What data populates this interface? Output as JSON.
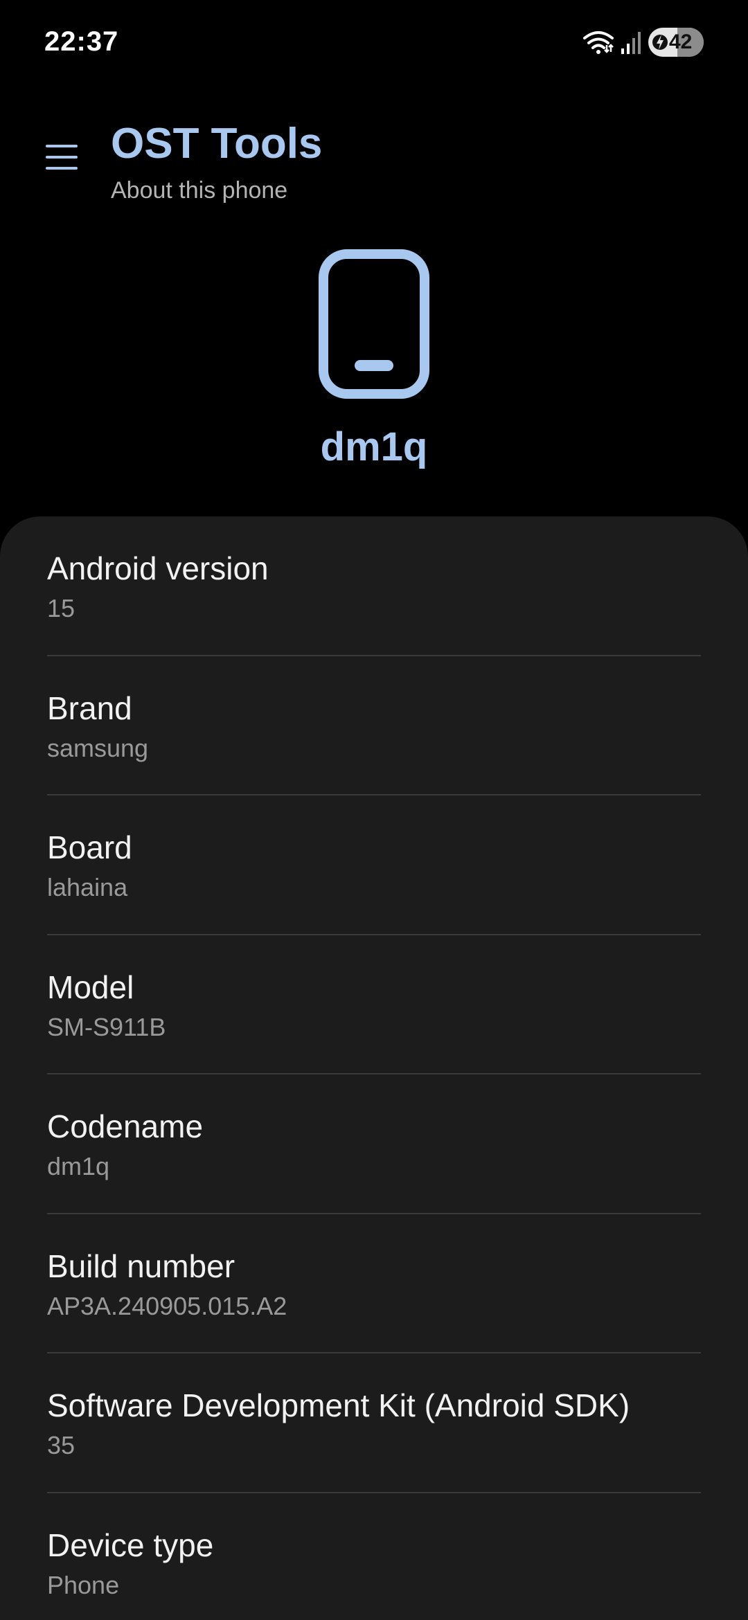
{
  "status_bar": {
    "time": "22:37",
    "battery_level": "42",
    "icons": [
      "wifi-icon",
      "cellular-signal-icon",
      "charging-bolt-icon"
    ]
  },
  "header": {
    "menu_icon": "hamburger-menu-icon",
    "title": "OST Tools",
    "subtitle": "About this phone"
  },
  "device": {
    "icon": "smartphone-icon",
    "name": "dm1q"
  },
  "info": [
    {
      "label": "Android version",
      "value": "15"
    },
    {
      "label": "Brand",
      "value": "samsung"
    },
    {
      "label": "Board",
      "value": "lahaina"
    },
    {
      "label": "Model",
      "value": "SM-S911B"
    },
    {
      "label": "Codename",
      "value": "dm1q"
    },
    {
      "label": "Build number",
      "value": "AP3A.240905.015.A2"
    },
    {
      "label": "Software Development Kit (Android SDK)",
      "value": "35"
    },
    {
      "label": "Device type",
      "value": "Phone"
    }
  ],
  "colors": {
    "accent": "#a8c8f0",
    "background": "#000000",
    "card": "#1c1c1c",
    "divider": "#3a3a3a",
    "secondary_text": "#9a9a9a"
  }
}
